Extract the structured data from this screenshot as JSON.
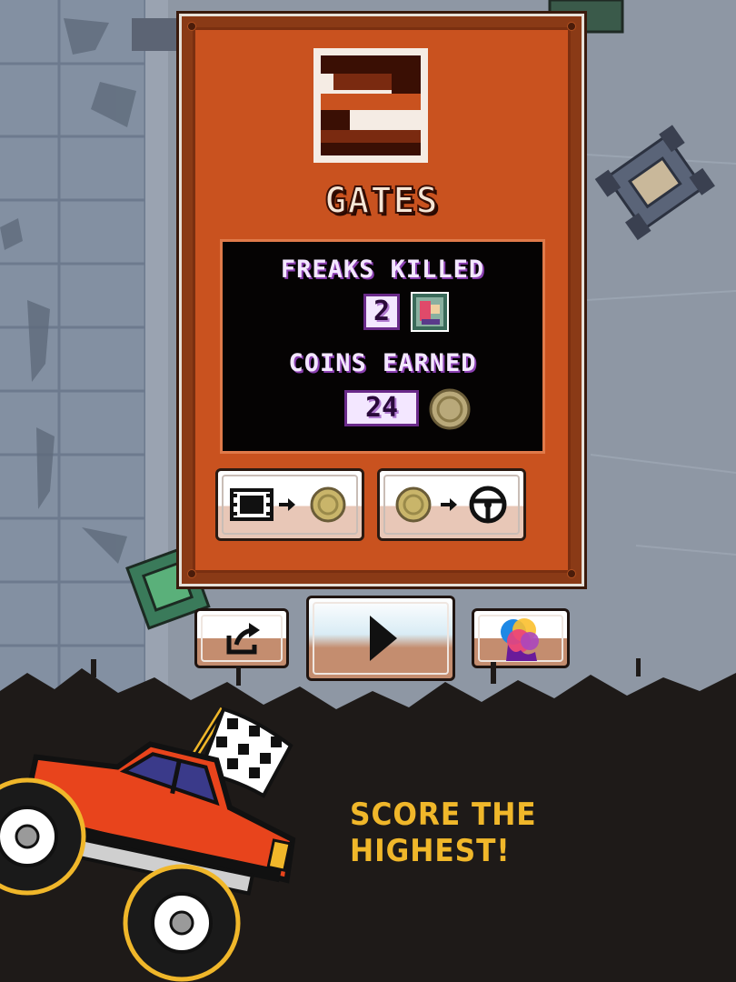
{
  "results": {
    "gates_count": "2",
    "gates_label": "GATES",
    "freaks_label": "FREAKS KILLED",
    "freaks_value": "2",
    "coins_label": "COINS EARNED",
    "coins_value": "24"
  },
  "buttons": {
    "video_to_coins": "video-to-coin",
    "coins_to_wheel": "coin-to-steering-wheel",
    "share": "share-icon",
    "play": "play-icon",
    "theme": "color-palette-icon"
  },
  "promo": {
    "tagline": "SCORE THE HIGHEST!"
  },
  "colors": {
    "panel": "#c9521f",
    "stats_bg": "#050303",
    "stat_text": "#f3e7ff",
    "promo_text": "#f0b72a",
    "ground": "#1e1a18"
  }
}
